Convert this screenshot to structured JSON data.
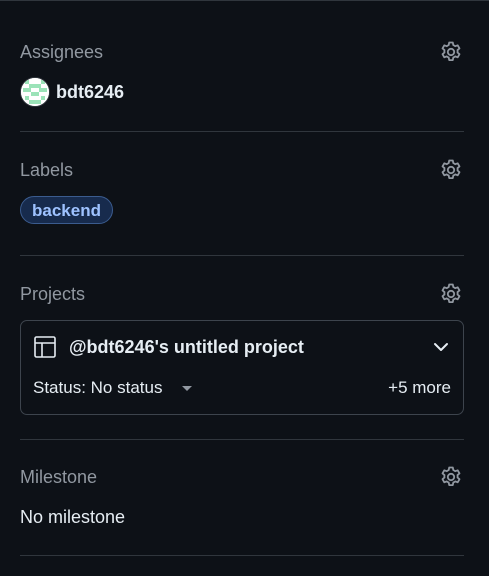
{
  "assignees": {
    "title": "Assignees",
    "gear_icon": "gear-icon",
    "users": [
      {
        "login": "bdt6246",
        "avatar_color": "#9be3b8"
      }
    ]
  },
  "labels": {
    "title": "Labels",
    "gear_icon": "gear-icon",
    "items": [
      {
        "name": "backend",
        "color": "#9ec2ff"
      }
    ]
  },
  "projects": {
    "title": "Projects",
    "gear_icon": "gear-icon",
    "project": {
      "icon": "table-icon",
      "name": "@bdt6246's untitled project",
      "expand_icon": "chevron-down-icon",
      "status_label": "Status: No status",
      "more": "+5 more"
    }
  },
  "milestone": {
    "title": "Milestone",
    "gear_icon": "gear-icon",
    "value": "No milestone"
  },
  "colors": {
    "background": "#0d1117",
    "border": "#30363d",
    "muted_text": "#9198a1",
    "text": "#e6edf3",
    "label_accent": "#9ec2ff"
  }
}
